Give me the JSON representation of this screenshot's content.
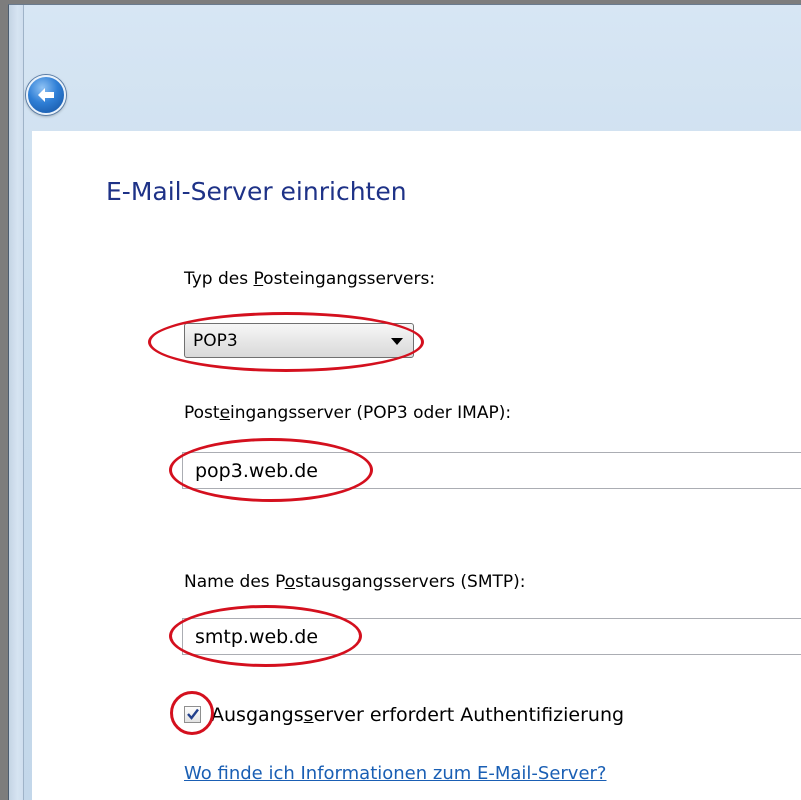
{
  "window": {
    "back_icon": "back-arrow-icon",
    "accent_color": "#1e3287"
  },
  "page": {
    "title": "E-Mail-Server einrichten"
  },
  "incoming_type": {
    "label_pre": "Typ des ",
    "label_accel": "P",
    "label_post": "osteingangsservers:",
    "selected": "POP3"
  },
  "incoming_server": {
    "label_pre": "Post",
    "label_accel": "e",
    "label_post": "ingangsserver (POP3 oder IMAP):",
    "value": "pop3.web.de"
  },
  "outgoing_server": {
    "label_pre": "Name des P",
    "label_accel": "o",
    "label_post": "stausgangsservers (SMTP):",
    "value": "smtp.web.de"
  },
  "auth": {
    "checked": true,
    "label_pre": "Ausgangs",
    "label_accel": "s",
    "label_post": "erver erfordert Authentifizierung"
  },
  "help_link": "Wo finde ich Informationen zum E-Mail-Server?",
  "highlight_color": "#d4101e"
}
